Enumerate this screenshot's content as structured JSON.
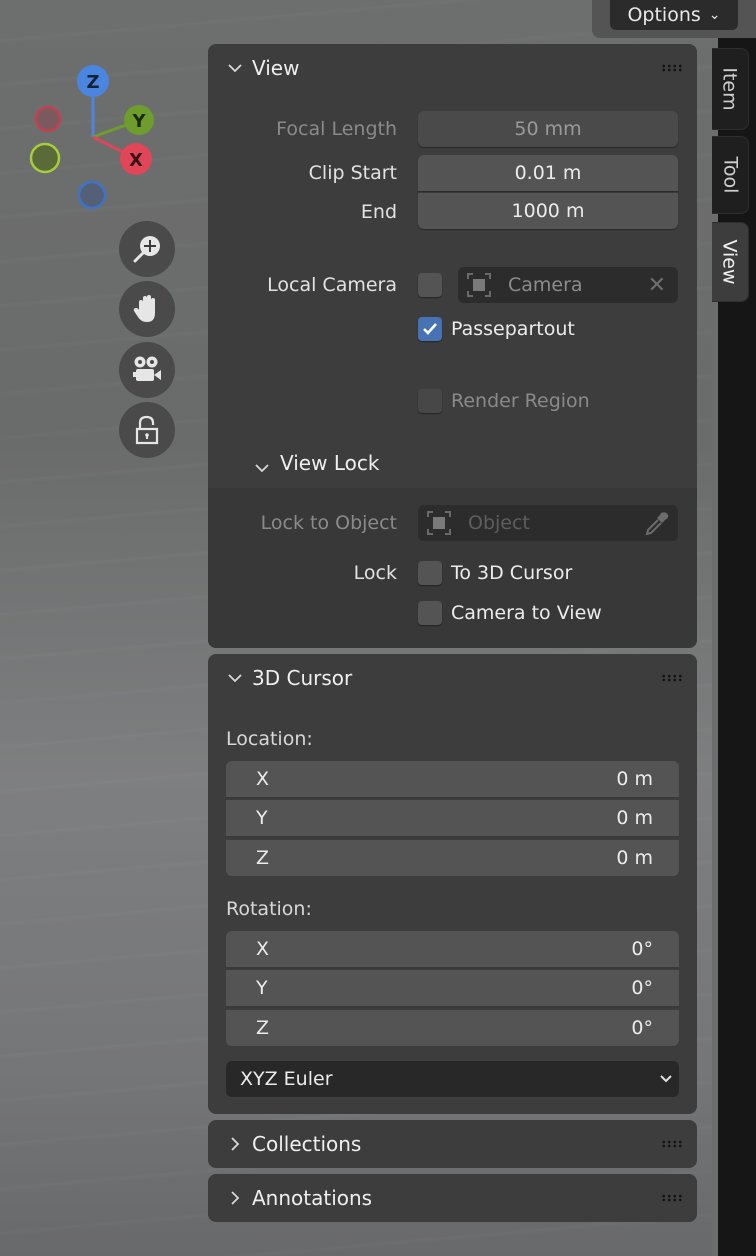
{
  "header": {
    "options_label": "Options"
  },
  "sidebar_tabs": [
    {
      "label": "Item",
      "active": false
    },
    {
      "label": "Tool",
      "active": false
    },
    {
      "label": "View",
      "active": true
    }
  ],
  "gizmo": {
    "axes": [
      {
        "label": "Z",
        "color": "#4a86e0"
      },
      {
        "label": "Y",
        "color": "#6e9d2e"
      },
      {
        "label": "X",
        "color": "#e04658"
      }
    ]
  },
  "nav_tools": [
    {
      "name": "zoom",
      "icon": "zoom-in-icon"
    },
    {
      "name": "pan",
      "icon": "hand-icon"
    },
    {
      "name": "camera",
      "icon": "camera-icon"
    },
    {
      "name": "lock",
      "icon": "unlock-icon"
    }
  ],
  "view_panel": {
    "title": "View",
    "focal_length": {
      "label": "Focal Length",
      "value": "50 mm"
    },
    "clip_start": {
      "label": "Clip Start",
      "value": "0.01 m"
    },
    "clip_end": {
      "label": "End",
      "value": "1000 m"
    },
    "local_camera": {
      "label": "Local Camera",
      "checked": false,
      "camera_placeholder": "Camera"
    },
    "passepartout": {
      "label": "Passepartout",
      "checked": true
    },
    "render_region": {
      "label": "Render Region",
      "checked": false
    },
    "view_lock": {
      "title": "View Lock",
      "lock_to_object": {
        "label": "Lock to Object",
        "placeholder": "Object"
      },
      "lock_label": "Lock",
      "to_3d_cursor": {
        "label": "To 3D Cursor",
        "checked": false
      },
      "camera_to_view": {
        "label": "Camera to View",
        "checked": false
      }
    }
  },
  "cursor_panel": {
    "title": "3D Cursor",
    "location_label": "Location:",
    "location": [
      {
        "axis": "X",
        "value": "0 m"
      },
      {
        "axis": "Y",
        "value": "0 m"
      },
      {
        "axis": "Z",
        "value": "0 m"
      }
    ],
    "rotation_label": "Rotation:",
    "rotation": [
      {
        "axis": "X",
        "value": "0°"
      },
      {
        "axis": "Y",
        "value": "0°"
      },
      {
        "axis": "Z",
        "value": "0°"
      }
    ],
    "rotation_mode": "XYZ Euler"
  },
  "collapsed_panels": [
    {
      "title": "Collections"
    },
    {
      "title": "Annotations"
    }
  ],
  "colors": {
    "accent_checkbox": "#4772b3",
    "panel_bg": "#3d3d3d",
    "field_bg": "#545454"
  }
}
